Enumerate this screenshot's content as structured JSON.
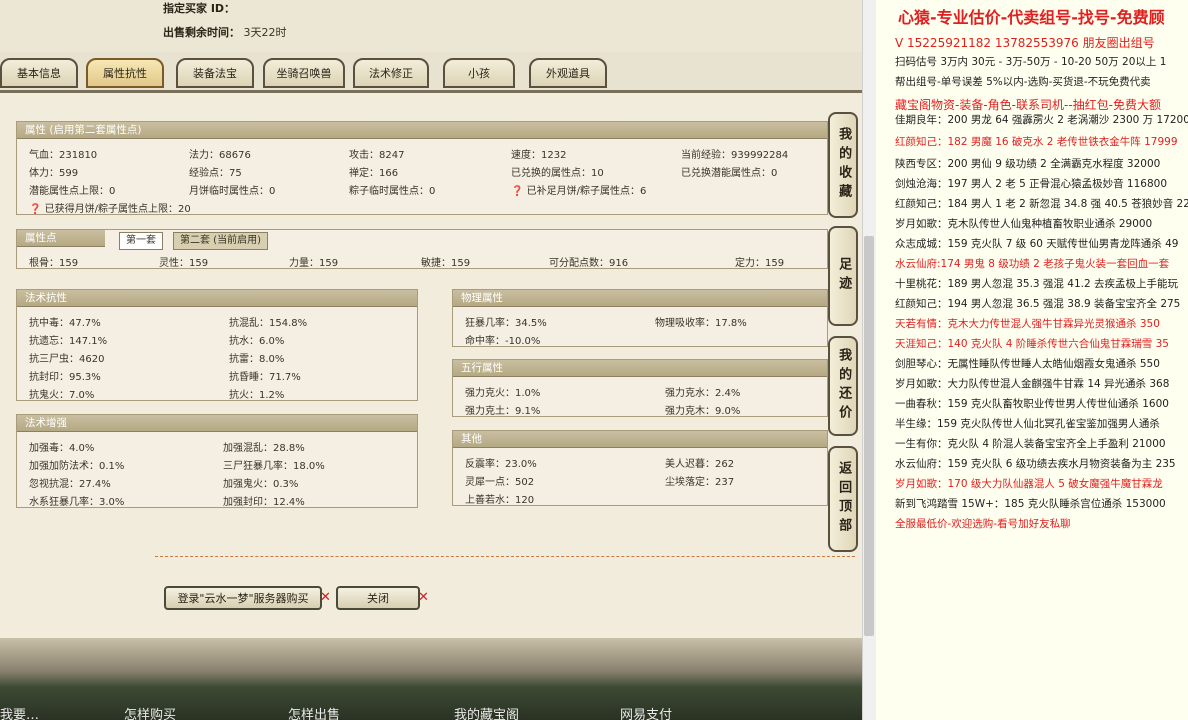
{
  "top": {
    "buyer_label": "指定买家 ID：",
    "remaining_label": "出售剩余时间：",
    "remaining_value": "3天22时"
  },
  "tabs": [
    "基本信息",
    "属性抗性",
    "装备法宝",
    "坐骑召唤兽",
    "法术修正",
    "小孩",
    "外观道具"
  ],
  "attr_panel": {
    "title": "属性 (启用第二套属性点)",
    "cells": [
      "气血：231810",
      "法力：68676",
      "攻击：8247",
      "速度：1232",
      "当前经验：939992284",
      "体力：599",
      "经验点：75",
      "禅定：166",
      "已兑换的属性点：10",
      "已兑换潜能属性点：0",
      "潜能属性点上限：0",
      "月饼临时属性点：0",
      "粽子临时属性点：0",
      "已补足月饼/粽子属性点：6",
      "已获得月饼/粽子属性点上限：20"
    ]
  },
  "points_panel": {
    "title": "属性点",
    "tab1": "第一套",
    "tab2": "第二套 (当前启用)",
    "cells": [
      "根骨：159",
      "灵性：159",
      "力量：159",
      "敏捷：159",
      "可分配点数：916",
      "定力：159"
    ]
  },
  "resist_panel": {
    "title": "法术抗性",
    "cells": [
      "抗中毒：47.7%",
      "抗混乱：154.8%",
      "抗遗忘：147.1%",
      "抗水：6.0%",
      "抗三尸虫：4620",
      "抗雷：8.0%",
      "抗封印：95.3%",
      "抗昏睡：71.7%",
      "抗鬼火：7.0%",
      "抗火：1.2%"
    ]
  },
  "boost_panel": {
    "title": "法术增强",
    "cells": [
      "加强毒：4.0%",
      "加强混乱：28.8%",
      "加强加防法术：0.1%",
      "三尸狂暴几率：18.0%",
      "忽视抗混：27.4%",
      "加强鬼火：0.3%",
      "水系狂暴几率：3.0%",
      "加强封印：12.4%"
    ]
  },
  "phys_panel": {
    "title": "物理属性",
    "cells": [
      "狂暴几率：34.5%",
      "物理吸收率：17.8%",
      "命中率：-10.0%"
    ]
  },
  "wuxing_panel": {
    "title": "五行属性",
    "cells": [
      "强力克火：1.0%",
      "强力克水：2.4%",
      "强力克土：9.1%",
      "强力克木：9.0%"
    ]
  },
  "other_panel": {
    "title": "其他",
    "cells": [
      "反震率：23.0%",
      "美人迟暮：262",
      "灵犀一点：502",
      "尘埃落定：237",
      "上善若水：120"
    ]
  },
  "buttons": {
    "buy": "登录\"云水一梦\"服务器购买",
    "close": "关闭"
  },
  "side_buttons": [
    "我的收藏",
    "足迹",
    "我的还价",
    "返回顶部"
  ],
  "bottom_nav": [
    "我要…",
    "怎样购买",
    "怎样出售",
    "我的藏宝阁",
    "网易支付"
  ],
  "side_doc": {
    "lines": [
      {
        "t": "心猿-专业估价-代卖组号-找号-免费顾",
        "c": "#e02020"
      },
      {
        "t": "V 15225921182   13782553976 朋友圈出组号",
        "c": "#e02020"
      },
      {
        "t": "扫码估号 3万内 30元 - 3万-50万 - 10-20 50万 20以上 1",
        "c": "#222"
      },
      {
        "t": "帮出组号-单号误差 5%以内-选购-买货退-不玩免费代卖",
        "c": "#222"
      },
      {
        "t": "藏宝阁物资-装备-角色-联系司机--抽红包-免费大额",
        "c": "#e02020"
      },
      {
        "t": "佳期良年：200 男龙 64 强霹雳火 2 老涡潮沙 2300 万 17200",
        "c": "#222"
      },
      {
        "t": "红颜知己：182 男魔 16 破克水 2 老传世铁衣金牛阵 17999",
        "c": "#e02020"
      },
      {
        "t": "陕西专区：200 男仙 9 级功绩 2 全满霸克水程度 32000",
        "c": "#222"
      },
      {
        "t": "剑烛沧海：197 男人 2 老 5 正骨混心猿孟极妙音 116800",
        "c": "#222"
      },
      {
        "t": "红颜知己：184 男人 1 老 2 新忽混 34.8 强 40.5 苍狼妙音 22",
        "c": "#222"
      },
      {
        "t": "岁月如歌：克木队传世人仙鬼种植畜牧职业通杀 29000",
        "c": "#222"
      },
      {
        "t": "众志成城：159 克火队 7 级 60 天赋传世仙男青龙阵通杀 49",
        "c": "#222"
      },
      {
        "t": "水云仙府:174 男鬼 8 级功绩 2 老孩子鬼火装一套回血一套",
        "c": "#e02020"
      },
      {
        "t": "十里桃花：189 男人忽混 35.3 强混 41.2 去疾孟极上手能玩",
        "c": "#222"
      },
      {
        "t": "红颜知己：194 男人忽混 36.5 强混 38.9 装备宝宝齐全 275",
        "c": "#222"
      },
      {
        "t": "天若有情：克木大力传世混人强牛甘霖异光灵猴通杀 350",
        "c": "#e02020"
      },
      {
        "t": "天涯知己：140 克火队 4 阶睡杀传世六合仙鬼甘霖瑞雪 35",
        "c": "#e02020"
      },
      {
        "t": "剑胆琴心：无属性睡队传世睡人太皓仙烟霞女鬼通杀 550",
        "c": "#222"
      },
      {
        "t": "岁月如歌：大力队传世混人金麒强牛甘霖 14 异光通杀 368",
        "c": "#222"
      },
      {
        "t": "一曲春秋：159 克火队畜牧职业传世男人传世仙通杀 1600",
        "c": "#222"
      },
      {
        "t": "半生缘：159 克火队传世人仙北冥孔雀宝鉴加强男人通杀",
        "c": "#222"
      },
      {
        "t": "一生有你：克火队 4 阶混人装备宝宝齐全上手盈利 21000",
        "c": "#222"
      },
      {
        "t": "水云仙府：159 克火队 6 级功绩去疾水月物资装备为主 235",
        "c": "#222"
      },
      {
        "t": "岁月如歌：170 级大力队仙器混人 5 破女魔强牛魔甘霖龙",
        "c": "#e02020"
      },
      {
        "t": "新到飞鸿踏雪 15W+：185 克火队睡杀宫位通杀 153000",
        "c": "#222"
      },
      {
        "t": "全服最低价-欢迎选购-看号加好友私聊",
        "c": "#e02020"
      }
    ]
  }
}
